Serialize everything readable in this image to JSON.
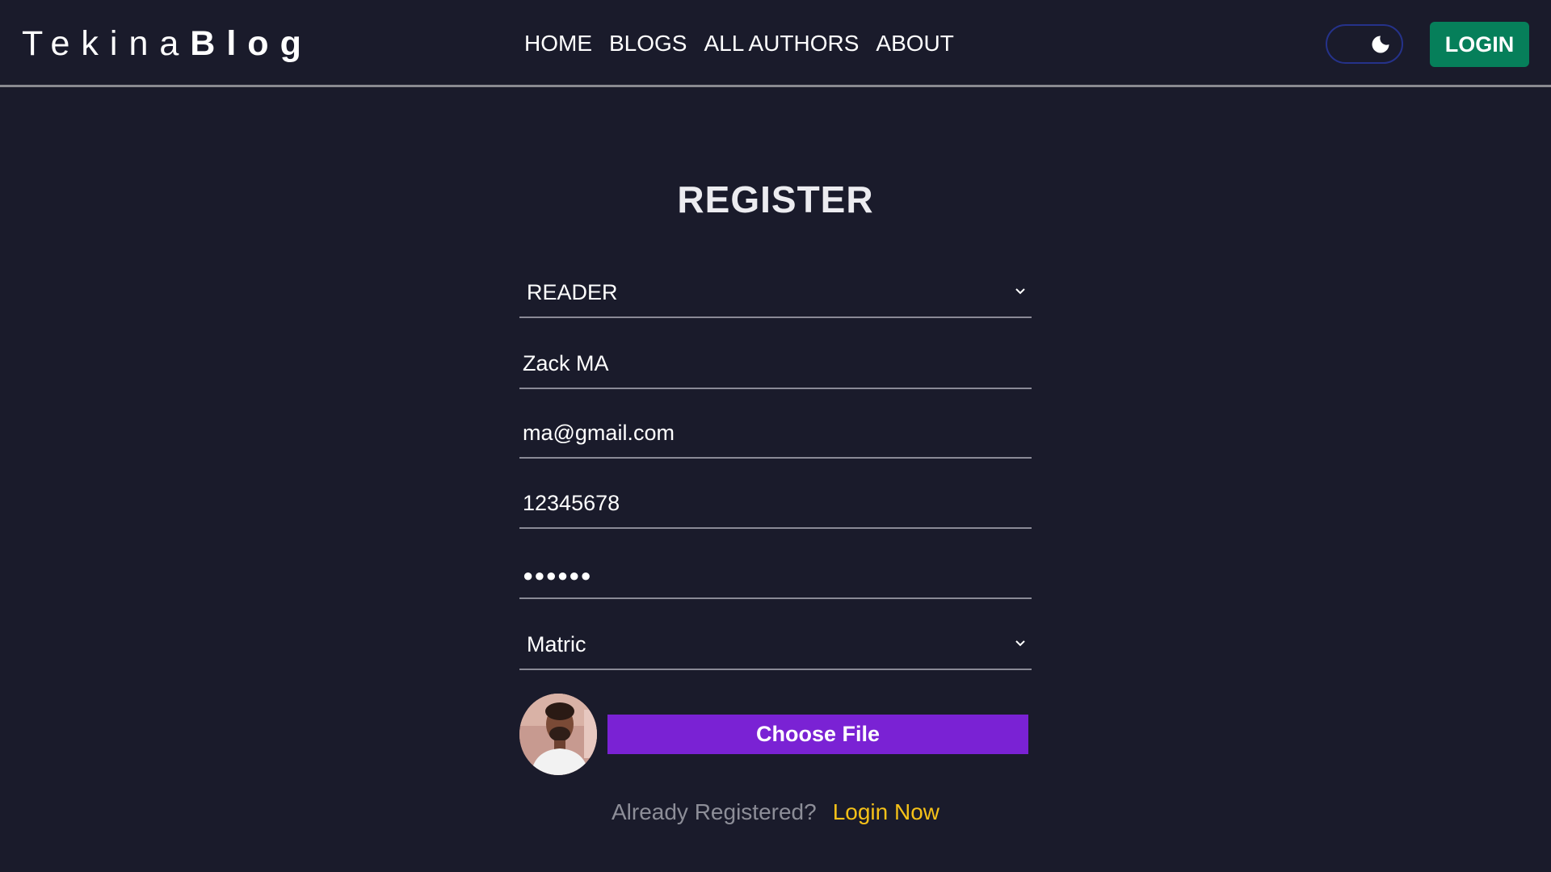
{
  "brand": {
    "light": "Tekina",
    "bold": "Blog"
  },
  "nav": {
    "links": [
      {
        "label": "HOME"
      },
      {
        "label": "BLOGS"
      },
      {
        "label": "ALL AUTHORS"
      },
      {
        "label": "ABOUT"
      }
    ],
    "theme_icon": "moon-icon",
    "login_label": "LOGIN"
  },
  "form": {
    "title": "REGISTER",
    "role": "READER",
    "name": "Zack MA",
    "email": "ma@gmail.com",
    "phone": "12345678",
    "password_masked": "●●●●●●",
    "education": "Matric",
    "avatar_icon": "profile-photo",
    "choose_file_label": "Choose File",
    "already_text": "Already Registered?",
    "login_now_label": "Login Now"
  },
  "colors": {
    "background": "#1a1b2b",
    "login_button": "#067f5a",
    "choose_file_button": "#7a22d4",
    "login_now_link": "#f5c118",
    "toggle_border": "#25328a"
  }
}
